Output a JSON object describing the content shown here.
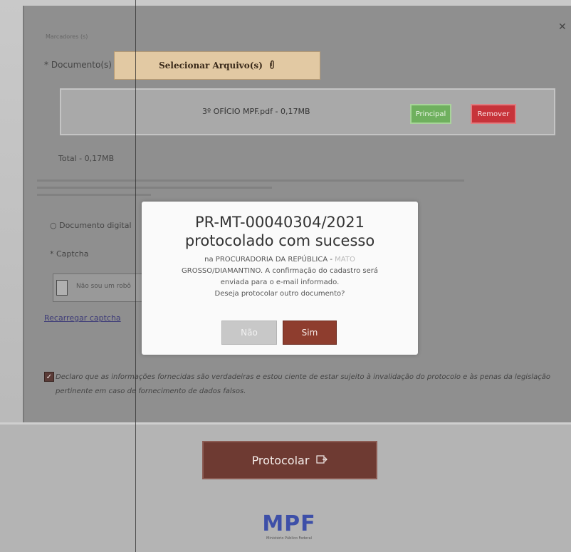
{
  "form": {
    "tiny_label": "Marcadores (s)",
    "documents_label": "Documento(s)",
    "select_file_label": "Selecionar Arquivo(s)",
    "file_name": "3º OFÍCIO MPF.pdf - 0,17MB",
    "principal_label": "Principal",
    "remover_label": "Remover",
    "total_label": "Total - 0,17MB",
    "digital_label": "Documento digital",
    "captcha_label": "Captcha",
    "captcha_robot_label": "Não sou um robô",
    "captcha_reset_label": "Recarregar captcha",
    "declaration_text": "Declaro que as informações fornecidas são verdadeiras e estou ciente de estar sujeito à invalidação do protocolo e às penas da legislação pertinente em caso de fornecimento de dados falsos."
  },
  "modal": {
    "title_line1": "PR-MT-00040304/2021",
    "title_line2": "protocolado com sucesso",
    "body_prefix": "na PROCURADORIA DA REPÚBLICA - ",
    "body_faded": "MATO",
    "body_line2": "GROSSO/DIAMANTINO. A confirmação do cadastro será",
    "body_line3": "enviada para o e-mail informado.",
    "body_line4": "Deseja protocolar outro documento?",
    "no_label": "Não",
    "yes_label": "Sim"
  },
  "footer": {
    "submit_label": "Protocolar",
    "logo_text": "MPF",
    "logo_subtitle": "Ministério Público Federal"
  },
  "icons": {
    "paperclip": "paperclip-icon",
    "submit": "document-send-icon",
    "close": "close-icon",
    "check": "checkmark-icon"
  },
  "colors": {
    "submit_bg": "#6e3a32",
    "yes_bg": "#8e3d2e",
    "principal_bg": "#6fb05e",
    "remover_bg": "#c7333a",
    "logo": "#3d4fa8"
  }
}
